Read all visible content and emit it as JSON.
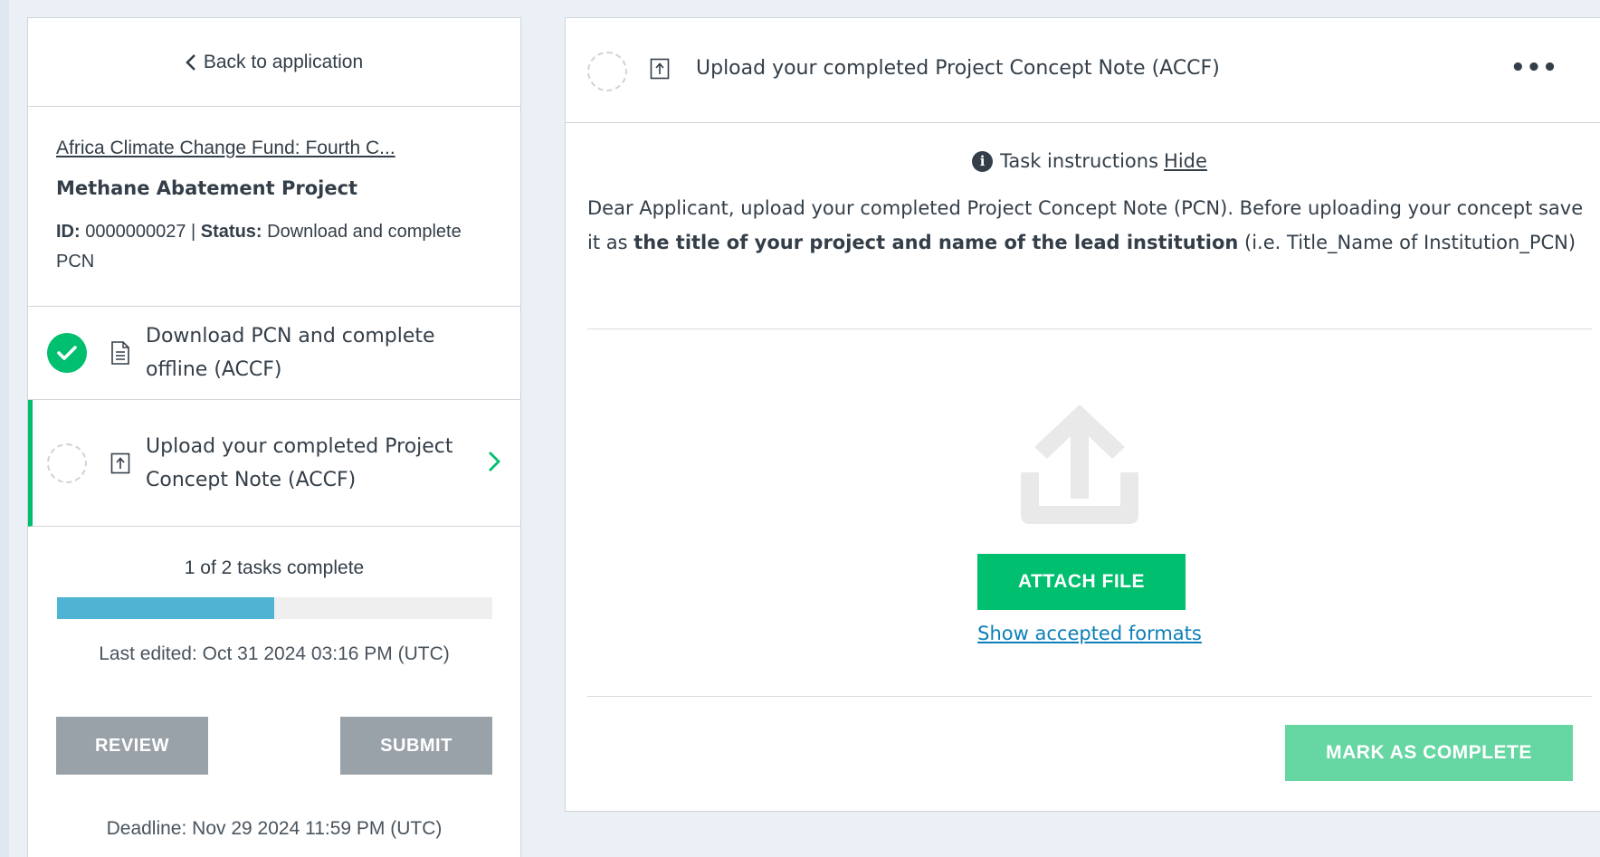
{
  "sidebar": {
    "back_label": "Back to application",
    "fund_link": "Africa Climate Change Fund: Fourth C...",
    "project_name": "Methane Abatement Project",
    "id_label": "ID:",
    "id_value": "0000000027",
    "status_label": "Status:",
    "status_value": "Download and complete PCN",
    "tasks": [
      {
        "label": "Download PCN and complete offline (ACCF)",
        "state": "complete",
        "icon": "document-icon"
      },
      {
        "label": "Upload your completed Project Concept Note (ACCF)",
        "state": "incomplete",
        "icon": "upload-icon",
        "active": true
      }
    ],
    "progress_text": "1 of 2 tasks complete",
    "progress_fraction": 0.5,
    "last_edited": "Last edited: Oct 31 2024 03:16 PM (UTC)",
    "review_label": "REVIEW",
    "submit_label": "SUBMIT",
    "deadline": "Deadline: Nov 29 2024 11:59 PM (UTC)"
  },
  "main": {
    "title": "Upload your completed Project Concept Note (ACCF)",
    "more_label": "•••",
    "instructions_label": "Task instructions",
    "hide_label": "Hide",
    "instructions_part1": "Dear Applicant, upload your completed Project Concept Note (PCN). Before uploading your concept save it as ",
    "instructions_bold": "the title of your project and name of the lead institution",
    "instructions_part2": " (i.e. Title_Name of Institution_PCN)",
    "attach_label": "ATTACH FILE",
    "formats_label": "Show accepted formats",
    "complete_label": "MARK AS COMPLETE"
  },
  "colors": {
    "accent_green": "#00bf6f",
    "progress_blue": "#4fb3d4",
    "disabled_gray": "#9aa2a9",
    "link_blue": "#0b7fb8"
  }
}
